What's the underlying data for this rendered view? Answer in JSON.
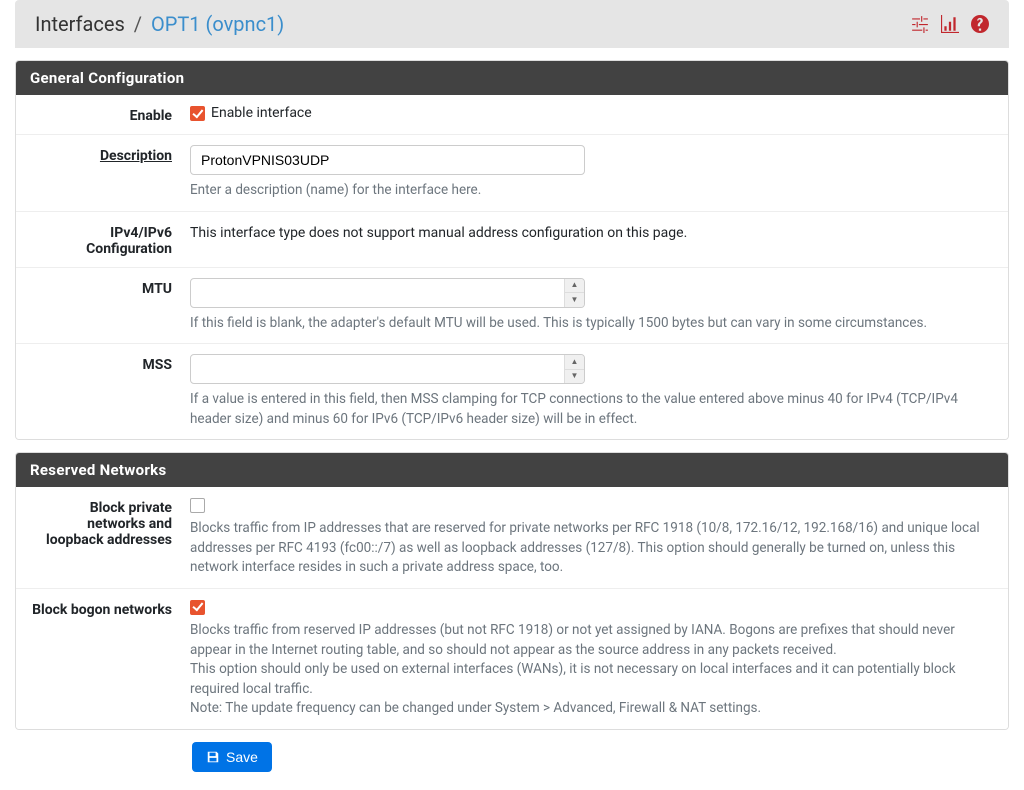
{
  "breadcrumb": {
    "root": "Interfaces",
    "current": "OPT1 (ovpnc1)"
  },
  "panels": {
    "general": {
      "title": "General Configuration",
      "enable": {
        "label": "Enable",
        "checkbox_label": "Enable interface",
        "checked": true
      },
      "description": {
        "label": "Description",
        "value": "ProtonVPNIS03UDP",
        "help": "Enter a description (name) for the interface here."
      },
      "ipconfig": {
        "label": "IPv4/IPv6 Configuration",
        "text": "This interface type does not support manual address configuration on this page."
      },
      "mtu": {
        "label": "MTU",
        "value": "",
        "help": "If this field is blank, the adapter's default MTU will be used. This is typically 1500 bytes but can vary in some circumstances."
      },
      "mss": {
        "label": "MSS",
        "value": "",
        "help": "If a value is entered in this field, then MSS clamping for TCP connections to the value entered above minus 40 for IPv4 (TCP/IPv4 header size) and minus 60 for IPv6 (TCP/IPv6 header size) will be in effect."
      }
    },
    "reserved": {
      "title": "Reserved Networks",
      "block_private": {
        "label": "Block private networks and loopback addresses",
        "checked": false,
        "help": "Blocks traffic from IP addresses that are reserved for private networks per RFC 1918 (10/8, 172.16/12, 192.168/16) and unique local addresses per RFC 4193 (fc00::/7) as well as loopback addresses (127/8). This option should generally be turned on, unless this network interface resides in such a private address space, too."
      },
      "block_bogon": {
        "label": "Block bogon networks",
        "checked": true,
        "help1": "Blocks traffic from reserved IP addresses (but not RFC 1918) or not yet assigned by IANA. Bogons are prefixes that should never appear in the Internet routing table, and so should not appear as the source address in any packets received.",
        "help2": "This option should only be used on external interfaces (WANs), it is not necessary on local interfaces and it can potentially block required local traffic.",
        "help3": "Note: The update frequency can be changed under System > Advanced, Firewall & NAT settings."
      }
    }
  },
  "buttons": {
    "save": "Save"
  }
}
